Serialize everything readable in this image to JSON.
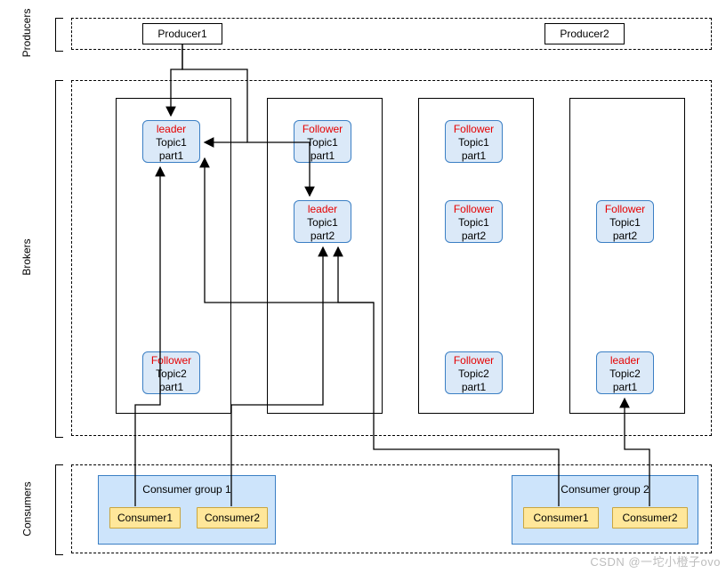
{
  "sections": {
    "producers": "Producers",
    "brokers": "Brokers",
    "consumers": "Consumers"
  },
  "producers": {
    "p1": "Producer1",
    "p2": "Producer2"
  },
  "roles": {
    "leader": "leader",
    "follower": "Follower"
  },
  "topics": {
    "t1p1": {
      "topic": "Topic1",
      "part": "part1"
    },
    "t1p2": {
      "topic": "Topic1",
      "part": "part2"
    },
    "t2p1": {
      "topic": "Topic2",
      "part": "part1"
    }
  },
  "consumer_groups": {
    "g1": {
      "title": "Consumer group 1",
      "c1": "Consumer1",
      "c2": "Consumer2"
    },
    "g2": {
      "title": "Consumer group 2",
      "c1": "Consumer1",
      "c2": "Consumer2"
    }
  },
  "watermark": "CSDN @一坨小橙子ovo"
}
